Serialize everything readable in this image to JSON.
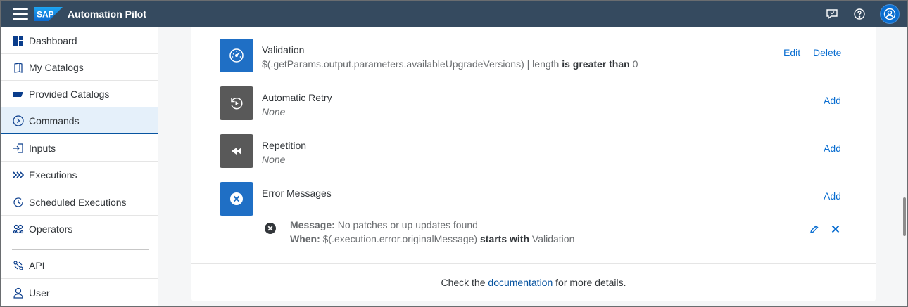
{
  "header": {
    "logo_text": "SAP",
    "app_title": "Automation Pilot",
    "menu_icon": "hamburger-icon",
    "feedback_icon": "feedback-icon",
    "help_icon": "help-icon",
    "avatar_icon": "user-avatar-icon",
    "bg_color": "#354a5f"
  },
  "sidebar": {
    "items": [
      {
        "label": "Dashboard",
        "icon": "dashboard-icon"
      },
      {
        "label": "My Catalogs",
        "icon": "catalog-icon"
      },
      {
        "label": "Provided Catalogs",
        "icon": "provided-catalog-icon"
      },
      {
        "label": "Commands",
        "icon": "command-icon",
        "selected": true
      },
      {
        "label": "Inputs",
        "icon": "input-icon"
      },
      {
        "label": "Executions",
        "icon": "executions-icon"
      },
      {
        "label": "Scheduled Executions",
        "icon": "clock-icon"
      },
      {
        "label": "Operators",
        "icon": "operators-icon"
      },
      {
        "label": "API",
        "icon": "api-icon"
      },
      {
        "label": "User",
        "icon": "user-icon"
      }
    ]
  },
  "main": {
    "validation": {
      "title": "Validation",
      "expr_prefix": "$(.getParams.output.parameters.availableUpgradeVersions) | length ",
      "expr_operator": "is greater than",
      "expr_value": " 0",
      "edit_label": "Edit",
      "delete_label": "Delete"
    },
    "automatic_retry": {
      "title": "Automatic Retry",
      "value": "None",
      "add_label": "Add"
    },
    "repetition": {
      "title": "Repetition",
      "value": "None",
      "add_label": "Add"
    },
    "error_messages": {
      "title": "Error Messages",
      "add_label": "Add",
      "message_label": "Message:",
      "message_value": " No patches or up updates found",
      "when_label": "When:",
      "when_expr": " $(.execution.error.originalMessage) ",
      "when_operator": "starts with",
      "when_value": " Validation"
    },
    "footer": {
      "prefix": "Check the ",
      "link": "documentation",
      "suffix": " for more details."
    }
  },
  "colors": {
    "accent": "#0a6ed1",
    "icon_blue": "#1f6fc5",
    "icon_gray": "#595959",
    "selected_bg": "#e5f0fa"
  }
}
